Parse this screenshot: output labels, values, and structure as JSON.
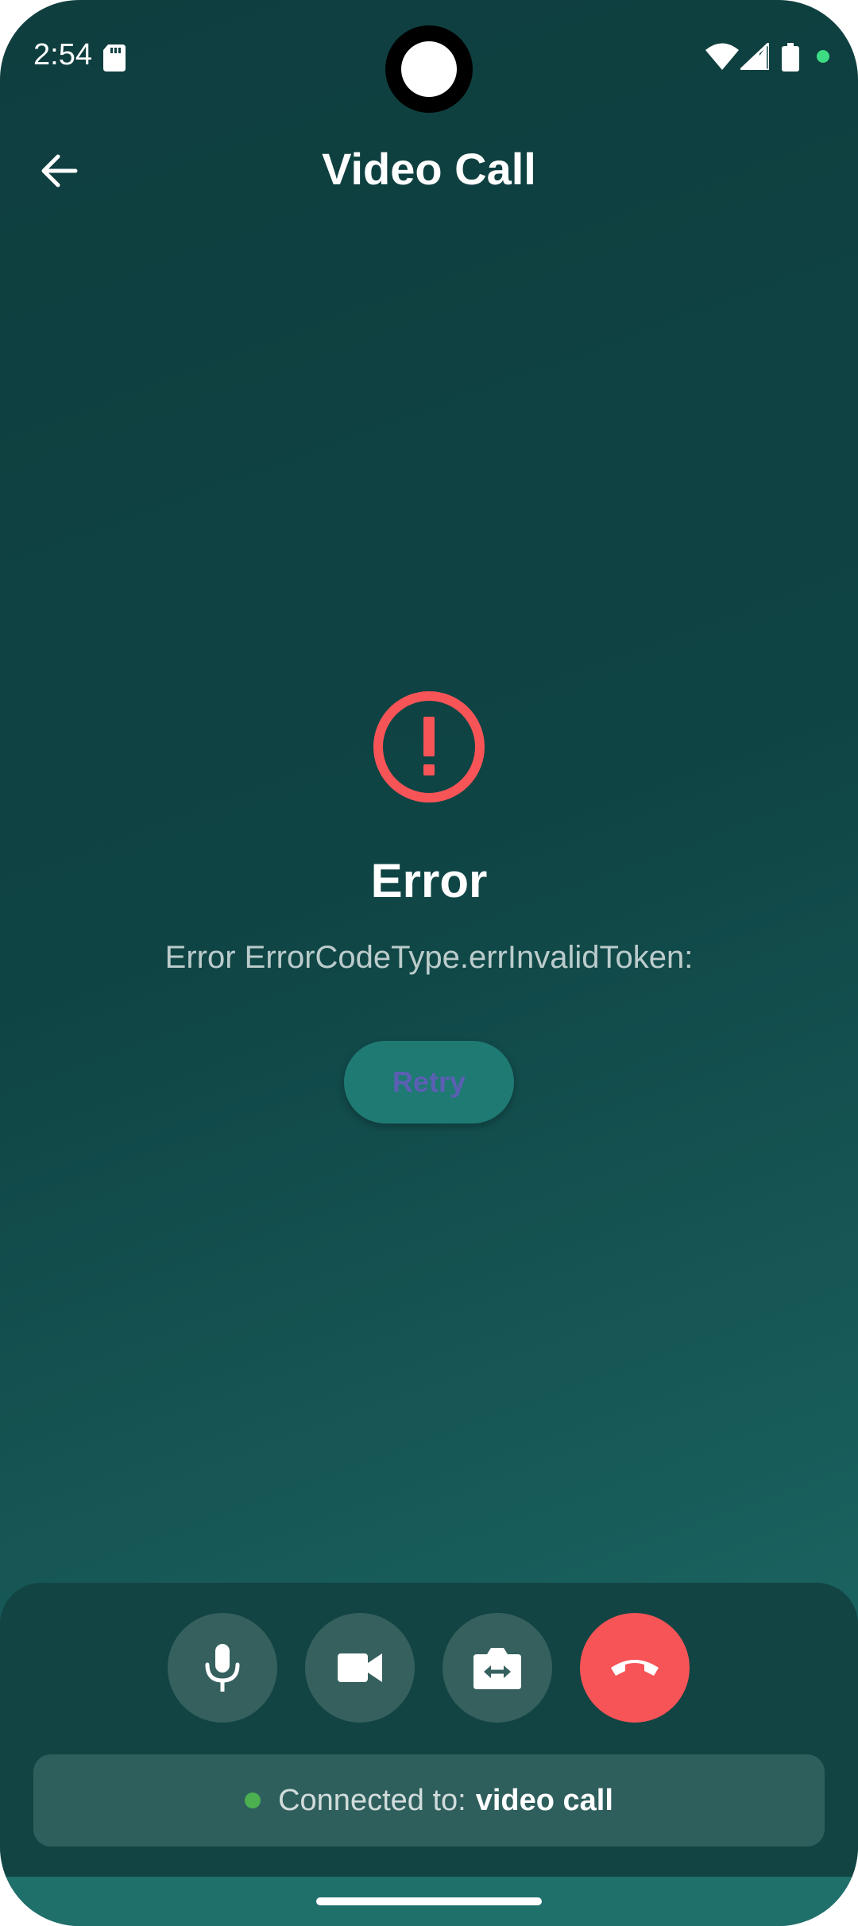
{
  "status_bar": {
    "time": "2:54",
    "icons": [
      "sd-card-icon",
      "wifi-icon",
      "signal-icon",
      "battery-icon"
    ],
    "privacy_indicator_color": "#3ddc84"
  },
  "app_bar": {
    "title": "Video Call",
    "back_icon": "arrow-back-icon"
  },
  "error": {
    "icon": "error-circle-icon",
    "icon_color": "#f75457",
    "title": "Error",
    "message": "Error ErrorCodeType.errInvalidToken:",
    "retry_label": "Retry"
  },
  "controls": {
    "buttons": [
      {
        "name": "mic",
        "icon": "microphone-icon"
      },
      {
        "name": "video",
        "icon": "videocam-icon"
      },
      {
        "name": "switch-camera",
        "icon": "switch-camera-icon"
      },
      {
        "name": "end-call",
        "icon": "call-end-icon",
        "color": "#f75457"
      }
    ],
    "connection": {
      "status_color": "#4caf50",
      "label": "Connected to:",
      "channel": "video call"
    }
  }
}
